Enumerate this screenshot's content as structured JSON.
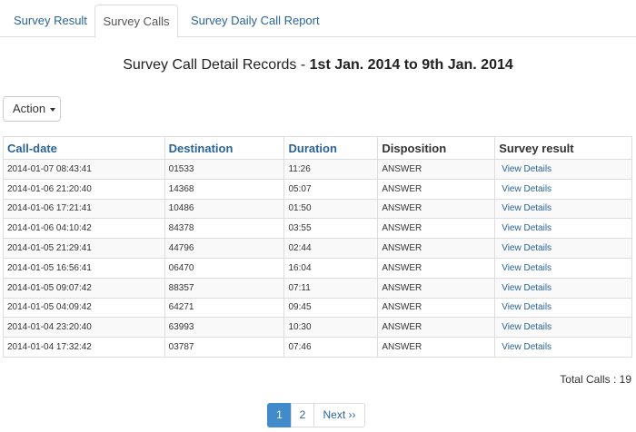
{
  "tabs": [
    {
      "label": "Survey Result"
    },
    {
      "label": "Survey Calls"
    },
    {
      "label": "Survey Daily Call Report"
    }
  ],
  "title": {
    "prefix": "Survey Call Detail Records - ",
    "range": "1st Jan. 2014 to 9th Jan. 2014"
  },
  "action_button": {
    "label": "Action"
  },
  "table": {
    "headers": [
      "Call-date",
      "Destination",
      "Duration",
      "Disposition",
      "Survey result"
    ],
    "rows": [
      {
        "date": "2014-01-07 08:43:41",
        "destination": "01533",
        "duration": "11:26",
        "disposition": "ANSWER",
        "link": "View Details"
      },
      {
        "date": "2014-01-06 21:20:40",
        "destination": "14368",
        "duration": "05:07",
        "disposition": "ANSWER",
        "link": "View Details"
      },
      {
        "date": "2014-01-06 17:21:41",
        "destination": "10486",
        "duration": "01:50",
        "disposition": "ANSWER",
        "link": "View Details"
      },
      {
        "date": "2014-01-06 04:10:42",
        "destination": "84378",
        "duration": "03:55",
        "disposition": "ANSWER",
        "link": "View Details"
      },
      {
        "date": "2014-01-05 21:29:41",
        "destination": "44796",
        "duration": "02:44",
        "disposition": "ANSWER",
        "link": "View Details"
      },
      {
        "date": "2014-01-05 16:56:41",
        "destination": "06470",
        "duration": "16:04",
        "disposition": "ANSWER",
        "link": "View Details"
      },
      {
        "date": "2014-01-05 09:07:42",
        "destination": "88357",
        "duration": "07:11",
        "disposition": "ANSWER",
        "link": "View Details"
      },
      {
        "date": "2014-01-05 04:09:42",
        "destination": "64271",
        "duration": "09:45",
        "disposition": "ANSWER",
        "link": "View Details"
      },
      {
        "date": "2014-01-04 23:20:40",
        "destination": "63993",
        "duration": "10:30",
        "disposition": "ANSWER",
        "link": "View Details"
      },
      {
        "date": "2014-01-04 17:32:42",
        "destination": "03787",
        "duration": "07:46",
        "disposition": "ANSWER",
        "link": "View Details"
      }
    ]
  },
  "total": {
    "label": "Total Calls : 19"
  },
  "pagination": {
    "page1": "1",
    "page2": "2",
    "next": "Next ››"
  }
}
